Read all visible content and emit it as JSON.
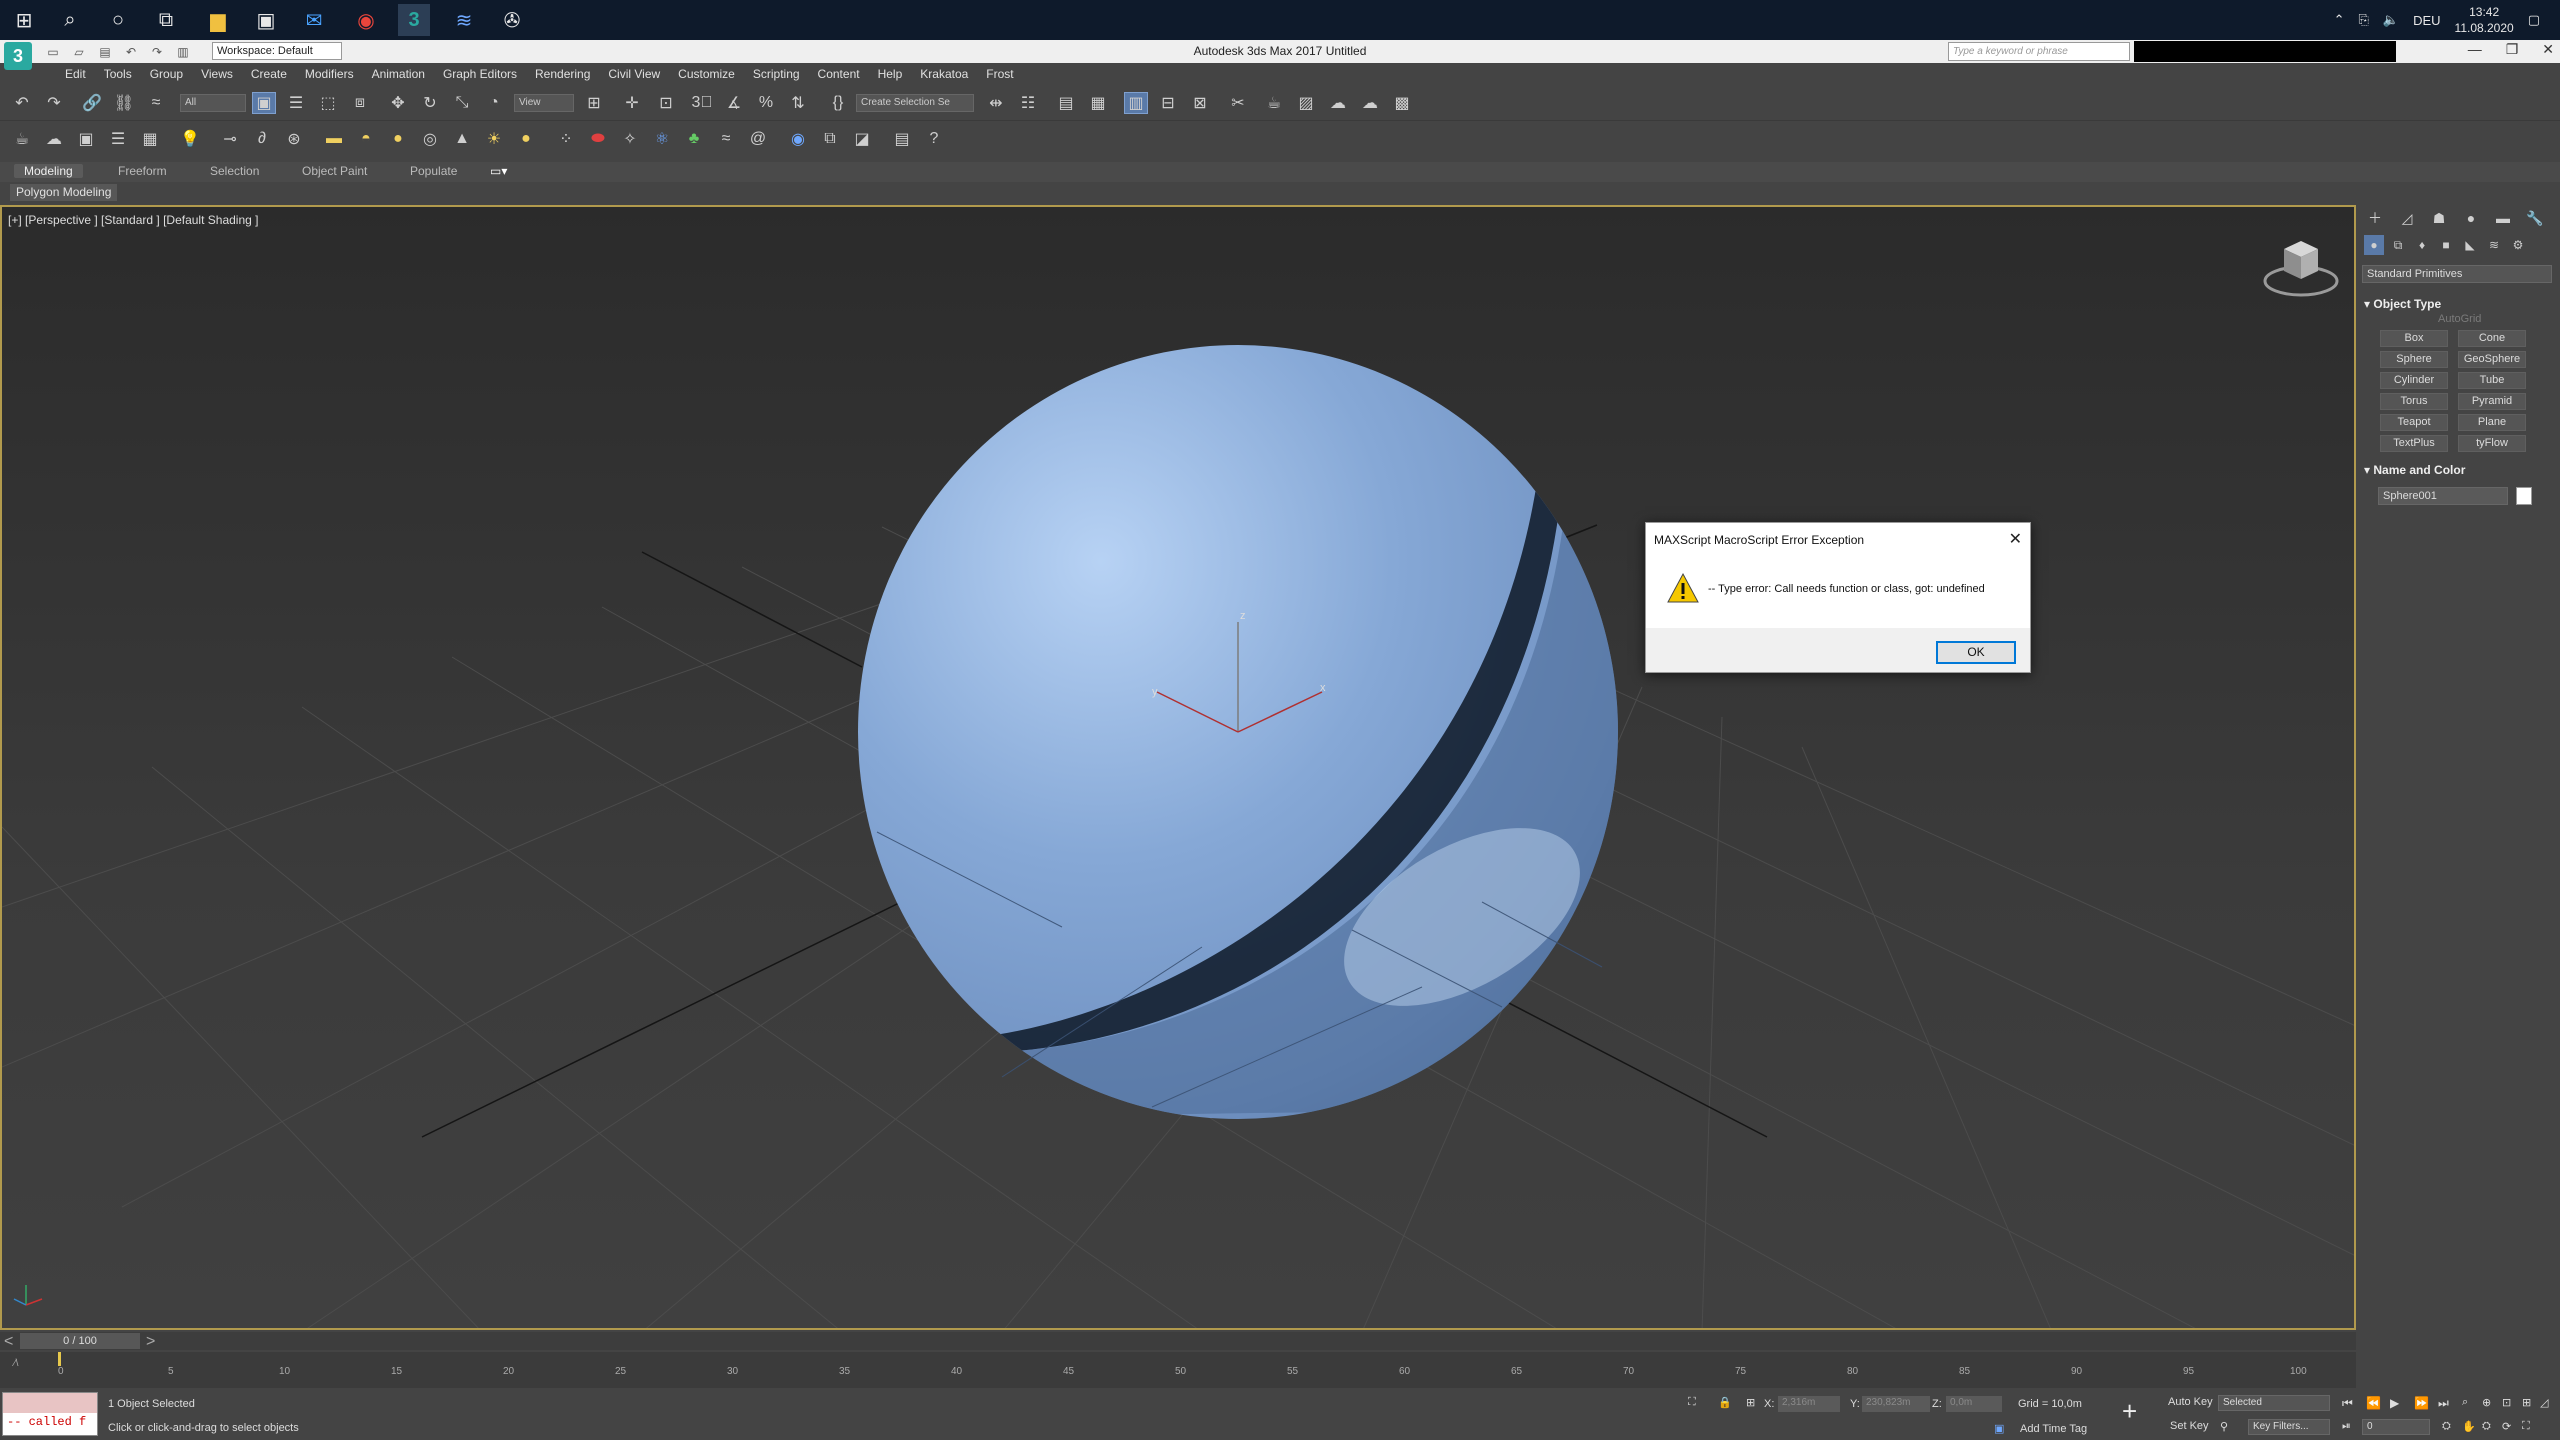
{
  "window": {
    "title": "Autodesk 3ds Max 2017    Untitled",
    "workspace": "Workspace: Default",
    "keyword_placeholder": "Type a keyword or phrase"
  },
  "taskbar": {
    "language": "DEU",
    "time": "13:42",
    "date": "11.08.2020"
  },
  "menus": [
    "Edit",
    "Tools",
    "Group",
    "Views",
    "Create",
    "Modifiers",
    "Animation",
    "Graph Editors",
    "Rendering",
    "Civil View",
    "Customize",
    "Scripting",
    "Content",
    "Help",
    "Krakatoa",
    "Frost"
  ],
  "toolbar": {
    "filter": "All",
    "refcoord": "View",
    "selection_set": "Create Selection Se"
  },
  "ribbon": {
    "tabs": [
      "Modeling",
      "Freeform",
      "Selection",
      "Object Paint",
      "Populate"
    ],
    "panel": "Polygon Modeling"
  },
  "viewport": {
    "label": "[+] [Perspective ] [Standard ] [Default Shading ]",
    "axis_z": "z",
    "axis_x": "x",
    "axis_y": "y"
  },
  "dialog": {
    "title": "MAXScript MacroScript Error Exception",
    "message": "-- Type error: Call needs function or class, got: undefined",
    "ok": "OK"
  },
  "command_panel": {
    "dropdown": "Standard Primitives",
    "object_type_header": "Object Type",
    "autogrid": "AutoGrid",
    "buttons": [
      "Box",
      "Cone",
      "Sphere",
      "GeoSphere",
      "Cylinder",
      "Tube",
      "Torus",
      "Pyramid",
      "Teapot",
      "Plane",
      "TextPlus",
      "tyFlow"
    ],
    "name_color_header": "Name and Color",
    "object_name": "Sphere001"
  },
  "timeline": {
    "frame": "0 / 100",
    "ticks": [
      "0",
      "5",
      "10",
      "15",
      "20",
      "25",
      "30",
      "35",
      "40",
      "45",
      "50",
      "55",
      "60",
      "65",
      "70",
      "75",
      "80",
      "85",
      "90",
      "95",
      "100"
    ]
  },
  "status": {
    "listener": "-- called f",
    "selected": "1 Object Selected",
    "prompt": "Click or click-and-drag to select objects",
    "x_label": "X:",
    "x_value": "2,316m",
    "y_label": "Y:",
    "y_value": "230,823m",
    "z_label": "Z:",
    "z_value": "0,0m",
    "grid": "Grid = 10,0m",
    "add_time_tag": "Add Time Tag",
    "auto_key": "Auto Key",
    "set_key": "Set Key",
    "key_mode": "Selected",
    "key_filters": "Key Filters...",
    "frame_field": "0"
  },
  "colors": {
    "sphere": "#7e9fcc",
    "viewport_border": "#b19a4d",
    "accent": "#5a7aa8"
  }
}
